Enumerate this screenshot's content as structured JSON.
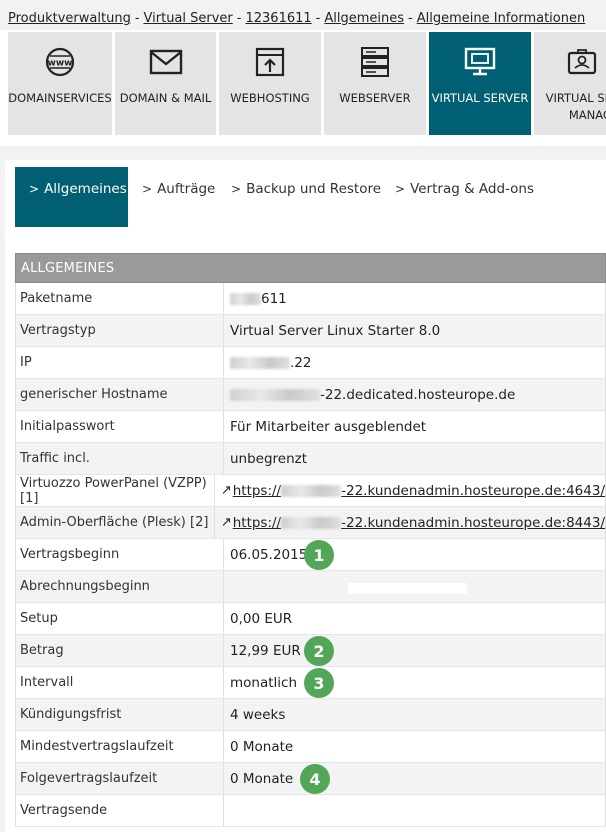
{
  "breadcrumb": {
    "items": [
      "Produktverwaltung",
      "Virtual Server",
      "12361611",
      "Allgemeines",
      "Allgemeine Informationen"
    ],
    "separator": "-"
  },
  "products": [
    {
      "label": "DOMAINSERVICES",
      "icon": "www-globe-icon"
    },
    {
      "label": "DOMAIN & MAIL",
      "icon": "envelope-icon"
    },
    {
      "label": "WEBHOSTING",
      "icon": "upload-window-icon"
    },
    {
      "label": "WEBSERVER",
      "icon": "server-rack-icon"
    },
    {
      "label": "VIRTUAL SERVER",
      "icon": "monitor-icon",
      "active": true
    },
    {
      "label": "VIRTUAL SERVER MANAGE",
      "icon": "id-card-icon"
    }
  ],
  "tabs": [
    {
      "label": "Allgemeines",
      "active": true
    },
    {
      "label": "Aufträge"
    },
    {
      "label": "Backup und Restore"
    },
    {
      "label": "Vertrag & Add-ons"
    }
  ],
  "section": {
    "title": "ALLGEMEINES"
  },
  "rows": [
    {
      "label": "Paketname",
      "value": "611"
    },
    {
      "label": "Vertragstyp",
      "value": "Virtual Server Linux Starter 8.0"
    },
    {
      "label": "IP",
      "value": ".22"
    },
    {
      "label": "generischer Hostname",
      "value": "-22.dedicated.hosteurope.de"
    },
    {
      "label": "Initialpasswort",
      "value": "Für Mitarbeiter ausgeblendet"
    },
    {
      "label": "Traffic incl.",
      "value": "unbegrenzt"
    },
    {
      "label": "Virtuozzo PowerPanel (VZPP) [1]",
      "value_prefix": "https://",
      "value": "-22.kundenadmin.hosteurope.de:4643/"
    },
    {
      "label": "Admin-Oberfläche (Plesk) [2]",
      "value_prefix": "https://",
      "value": "-22.kundenadmin.hosteurope.de:8443/"
    },
    {
      "label": "Vertragsbeginn",
      "value": "06.05.2015",
      "badge": "1"
    },
    {
      "label": "Abrechnungsbeginn",
      "value": ""
    },
    {
      "label": "Setup",
      "value": "0,00 EUR"
    },
    {
      "label": "Betrag",
      "value": "12,99 EUR",
      "badge": "2"
    },
    {
      "label": "Intervall",
      "value": "monatlich",
      "badge": "3"
    },
    {
      "label": "Kündigungsfrist",
      "value": "4 weeks"
    },
    {
      "label": "Mindestvertragslaufzeit",
      "value": "0 Monate"
    },
    {
      "label": "Folgevertragslaufzeit",
      "value": "0 Monate",
      "badge": "4"
    },
    {
      "label": "Vertragsende",
      "value": ""
    }
  ],
  "colors": {
    "accent": "#005f73",
    "badge": "#53a658",
    "header": "#9a9a9a"
  }
}
